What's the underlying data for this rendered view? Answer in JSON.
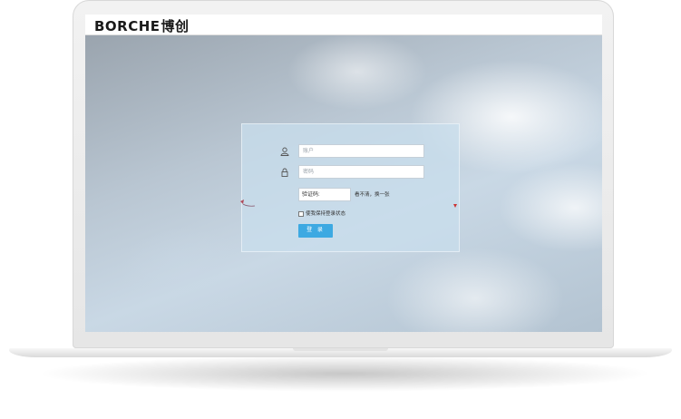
{
  "header": {
    "logo_latin": "BORCHE",
    "logo_cn": "博创"
  },
  "login": {
    "username_placeholder": "账户",
    "password_placeholder": "密码",
    "captcha_label": "验证码:",
    "captcha_refresh": "看不清，换一张",
    "remember_label": "使我保持登录状态",
    "submit_label": "登 录"
  },
  "colors": {
    "button": "#3da9e2",
    "panel": "#c8deec"
  },
  "icons": [
    "user-icon",
    "lock-icon"
  ]
}
